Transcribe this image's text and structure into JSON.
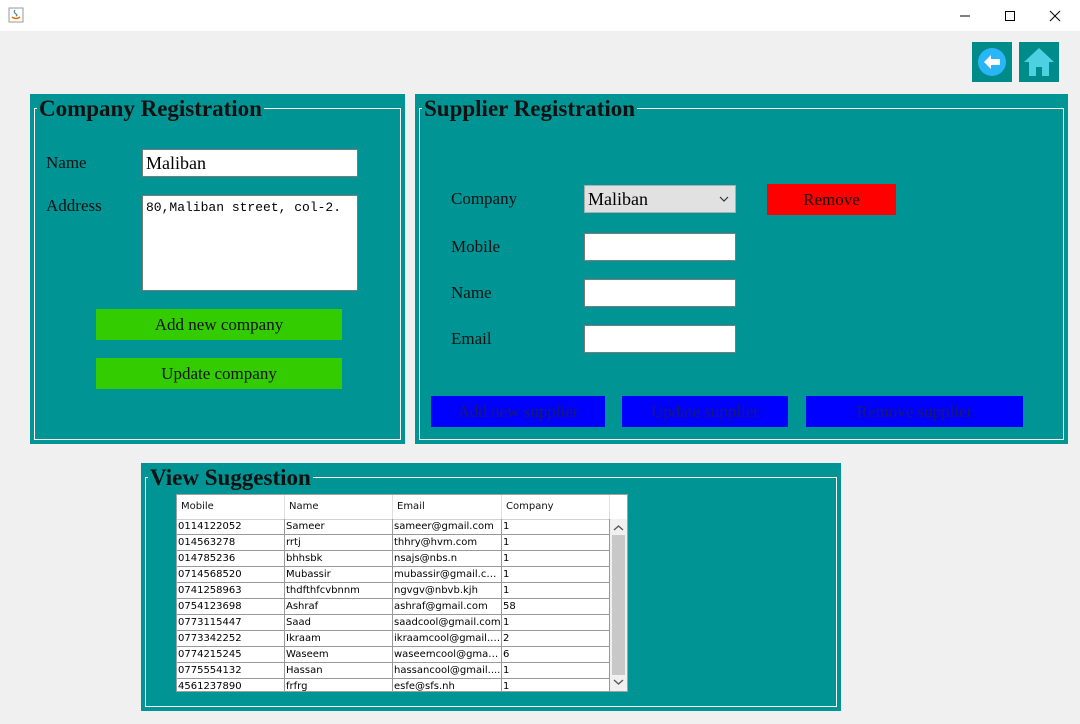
{
  "window": {
    "minimize_icon": "minimize-icon",
    "maximize_icon": "maximize-icon",
    "close_icon": "close-icon"
  },
  "nav": {
    "back_icon": "back-arrow-icon",
    "home_icon": "home-icon"
  },
  "company": {
    "title": "Company Registration",
    "name_label": "Name",
    "name_value": "Maliban",
    "address_label": "Address",
    "address_value": "80,Maliban street, col-2.",
    "add_button": "Add new company",
    "update_button": "Update company"
  },
  "supplier": {
    "title": "Supplier Registration",
    "company_label": "Company",
    "company_selected": "Maliban",
    "remove_button": "Remove",
    "mobile_label": "Mobile",
    "mobile_value": "",
    "name_label": "Name",
    "name_value": "",
    "email_label": "Email",
    "email_value": "",
    "add_button": "Add new supplier",
    "update_button": "Update supplier",
    "remove_supplier_button": "Remove supplier"
  },
  "suggestion": {
    "title": "View Suggestion",
    "columns": [
      "Mobile",
      "Name",
      "Email",
      "Company"
    ],
    "rows": [
      [
        "0114122052",
        "Sameer",
        "sameer@gmail.com",
        "1"
      ],
      [
        "014563278",
        "rrtj",
        "thhry@hvm.com",
        "1"
      ],
      [
        "014785236",
        "bhhsbk",
        "nsajs@nbs.n",
        "1"
      ],
      [
        "0714568520",
        "Mubassir",
        "mubassir@gmail.com",
        "1"
      ],
      [
        "0741258963",
        "thdfthfcvbnnm",
        "ngvgv@nbvb.kjh",
        "1"
      ],
      [
        "0754123698",
        "Ashraf",
        "ashraf@gmail.com",
        "58"
      ],
      [
        "0773115447",
        "Saad",
        "saadcool@gmail.com",
        "1"
      ],
      [
        "0773342252",
        "Ikraam",
        "ikraamcool@gmail.c...",
        "2"
      ],
      [
        "0774215245",
        "Waseem",
        "waseemcool@gmail....",
        "6"
      ],
      [
        "0775554132",
        "Hassan",
        "hassancool@gmail....",
        "1"
      ],
      [
        "4561237890",
        "frfrg",
        "esfe@sfs.nh",
        "1"
      ]
    ]
  },
  "colors": {
    "panel": "#009494",
    "green_button": "#33cc00",
    "blue_button": "#0000ff",
    "red_button": "#ff0000"
  }
}
